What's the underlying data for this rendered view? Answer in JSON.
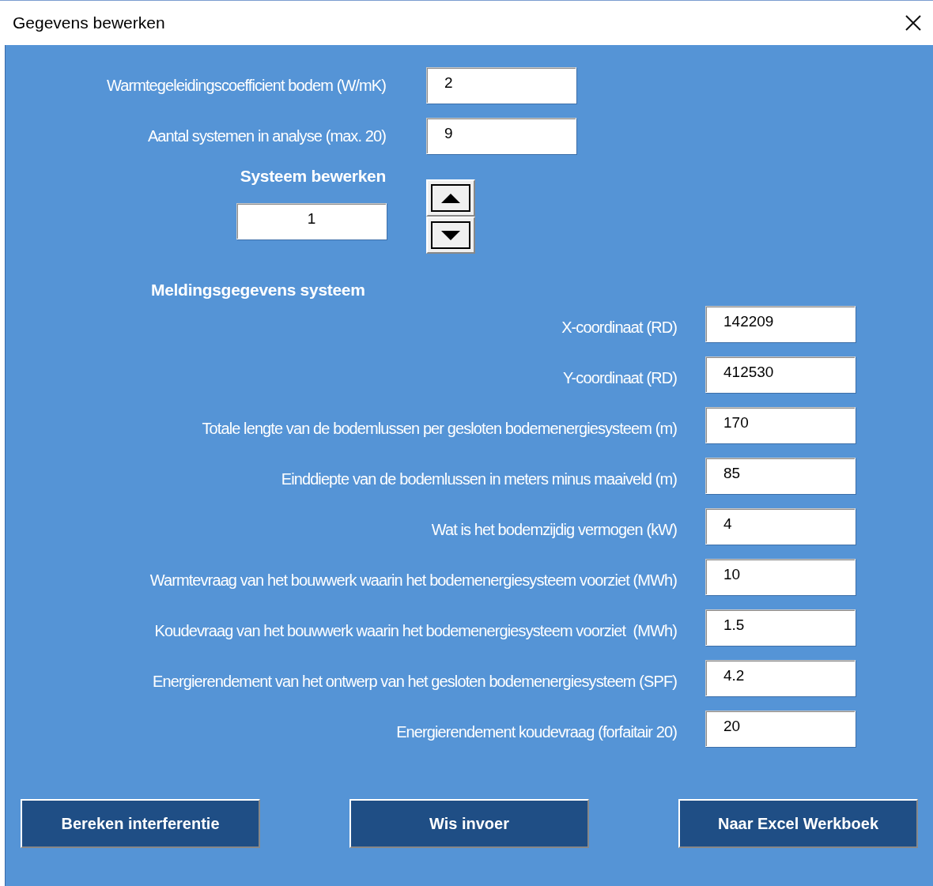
{
  "window": {
    "title": "Gegevens bewerken"
  },
  "general": [
    {
      "label": "Warmtegeleidingscoefficient bodem (W/mK)",
      "value": "2"
    },
    {
      "label": "Aantal systemen in analyse (max. 20)",
      "value": "9"
    }
  ],
  "system_selector": {
    "heading": "Systeem bewerken",
    "value": "1"
  },
  "details": {
    "heading": "Meldingsgegevens systeem",
    "fields": [
      {
        "label": "X-coordinaat (RD)",
        "value": "142209"
      },
      {
        "label": "Y-coordinaat (RD)",
        "value": "412530"
      },
      {
        "label": "Totale lengte van de bodemlussen per gesloten bodemenergiesysteem (m)",
        "value": "170"
      },
      {
        "label": "Einddiepte van de bodemlussen in meters minus maaiveld (m)",
        "value": "85"
      },
      {
        "label": "Wat is het bodemzijdig vermogen (kW)",
        "value": "4"
      },
      {
        "label": "Warmtevraag van het bouwwerk waarin het bodemenergiesysteem voorziet (MWh)",
        "value": "10"
      },
      {
        "label": "Koudevraag van het bouwwerk waarin het bodemenergiesysteem voorziet  (MWh)",
        "value": "1.5"
      },
      {
        "label": "Energierendement van het ontwerp van het gesloten bodemenergiesysteem (SPF)",
        "value": "4.2"
      },
      {
        "label": "Energierendement koudevraag (forfaitair 20)",
        "value": "20"
      }
    ]
  },
  "buttons": [
    "Bereken interferentie",
    "Wis invoer",
    "Naar Excel Werkboek"
  ]
}
